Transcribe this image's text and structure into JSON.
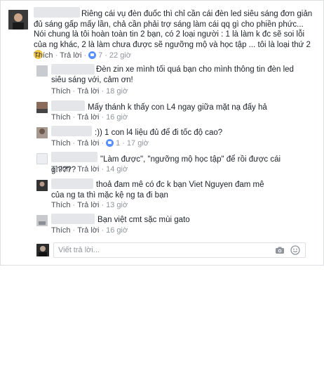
{
  "comments": [
    {
      "text": "Riêng cái vụ đèn đuốc thì chỉ cần cái đèn led siêu sáng đơn giản đủ sáng gấp mấy lần, chả cần phải trợ sáng làm cái qq gì cho phiền phức... Nói chung là tôi hoàn toàn tin 2 bạn, có 2 loại người : 1 là làm k đc sẽ soi lỗi của ng khác, 2 là làm chưa được sẽ ngưỡng mộ và học tập ... tôi là loại thứ 2",
      "like_label": "Thích",
      "reply_label": "Trả lời",
      "like_count": "7",
      "time": "22 giờ"
    }
  ],
  "replies": [
    {
      "text": "Đèn zin xe mình tối quá bạn cho mình thông tin đèn led siêu sáng với, cảm ơn!",
      "like_label": "Thích",
      "reply_label": "Trả lời",
      "time": "18 giờ"
    },
    {
      "text": "Mấy thánh k thấy con L4 ngay giữa mặt nạ đấy hả",
      "like_label": "Thích",
      "reply_label": "Trả lời",
      "time": "16 giờ"
    },
    {
      "text": ":)) 1 con l4 liệu đủ để đi tốc độ cao?",
      "like_label": "Thích",
      "reply_label": "Trả lời",
      "like_count": "1",
      "time": "17 giờ"
    },
    {
      "text": "\"Làm được\", \"ngưỡng mộ học tập\" để rồi được cái gì????",
      "like_label": "Thích",
      "reply_label": "Trả lời",
      "time": "14 giờ"
    },
    {
      "text": "thoả đam mê có đc k bạn Viet Nguyen đam mê của ng ta thì mặc kệ ng ta đi bạn",
      "like_label": "Thích",
      "reply_label": "Trả lời",
      "time": "13 giờ"
    },
    {
      "text": "Bạn việt cmt sặc mùi gato",
      "like_label": "Thích",
      "reply_label": "Trả lời",
      "time": "16 giờ"
    }
  ],
  "reply_input": {
    "placeholder": "Viết trả lời..."
  },
  "colors": {
    "link": "#4b4f56",
    "meta": "#90949c",
    "like_badge": "#5890ff",
    "border": "#dddfe2"
  },
  "icons": [
    "smiley-emoji-icon",
    "like-badge-icon",
    "camera-icon",
    "emoji-icon"
  ]
}
